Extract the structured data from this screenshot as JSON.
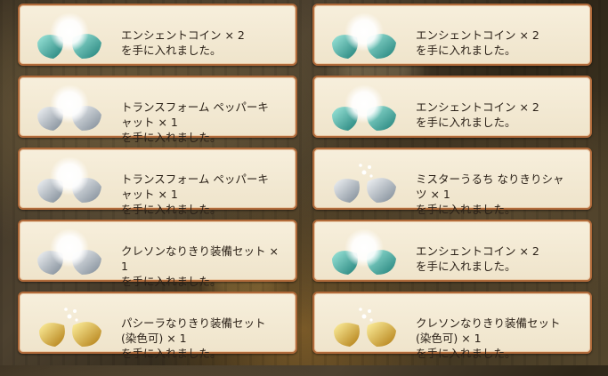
{
  "cards": [
    {
      "name": "エンシェントコイン × 2",
      "msg": "を手に入れました。",
      "orb": "teal"
    },
    {
      "name": "エンシェントコイン × 2",
      "msg": "を手に入れました。",
      "orb": "teal"
    },
    {
      "name": "トランスフォーム ペッパーキ\nャット × 1",
      "msg": "を手に入れました。",
      "orb": "silver"
    },
    {
      "name": "エンシェントコイン × 2",
      "msg": "を手に入れました。",
      "orb": "teal"
    },
    {
      "name": "トランスフォーム ペッパーキ\nャット × 1",
      "msg": "を手に入れました。",
      "orb": "silver"
    },
    {
      "name": "ミスターうるち なりきりシャ\nツ × 1",
      "msg": "を手に入れました。",
      "orb": "silver-open"
    },
    {
      "name": "クレソンなりきり装備セット ×\n1",
      "msg": "を手に入れました。",
      "orb": "silver"
    },
    {
      "name": "エンシェントコイン × 2",
      "msg": "を手に入れました。",
      "orb": "teal"
    },
    {
      "name": "パシーラなりきり装備セット\n(染色可) × 1",
      "msg": "を手に入れました。",
      "orb": "gold"
    },
    {
      "name": "クレソンなりきり装備セット\n(染色可) × 1",
      "msg": "を手に入れました。",
      "orb": "gold"
    }
  ],
  "colors": {
    "teal": "#3aa89a",
    "silver": "#b8c0c8",
    "gold": "#d9a520",
    "border": "#b06a3a"
  }
}
